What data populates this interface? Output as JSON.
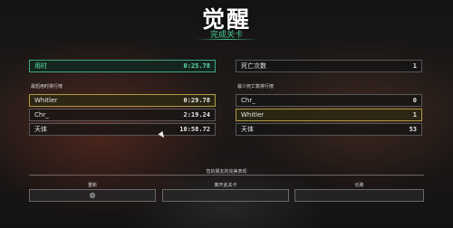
{
  "header": {
    "title": "觉醒",
    "subtitle": "完成关卡"
  },
  "left_panel": {
    "time_label": "用时",
    "time_value": "0:25.78",
    "section_label": "最短用时排行榜",
    "rows": [
      {
        "name": "Whitler",
        "value": "0:29.78"
      },
      {
        "name": "Chr_",
        "value": "2:19.24"
      },
      {
        "name": "天体",
        "value": "10:58.72"
      }
    ]
  },
  "right_panel": {
    "deaths_label": "死亡次数",
    "deaths_value": "1",
    "section_label": "最少死亡数排行榜",
    "rows": [
      {
        "name": "Chr_",
        "value": "0"
      },
      {
        "name": "Whitler",
        "value": "1"
      },
      {
        "name": "天体",
        "value": "53"
      }
    ]
  },
  "footer": {
    "note": "您的朋友的完美表现",
    "buttons": [
      {
        "label": "重新"
      },
      {
        "label": "离开此关卡"
      },
      {
        "label": "长跑"
      }
    ]
  },
  "colors": {
    "accent_green": "#45d39a",
    "gold_highlight": "#beaa46"
  }
}
